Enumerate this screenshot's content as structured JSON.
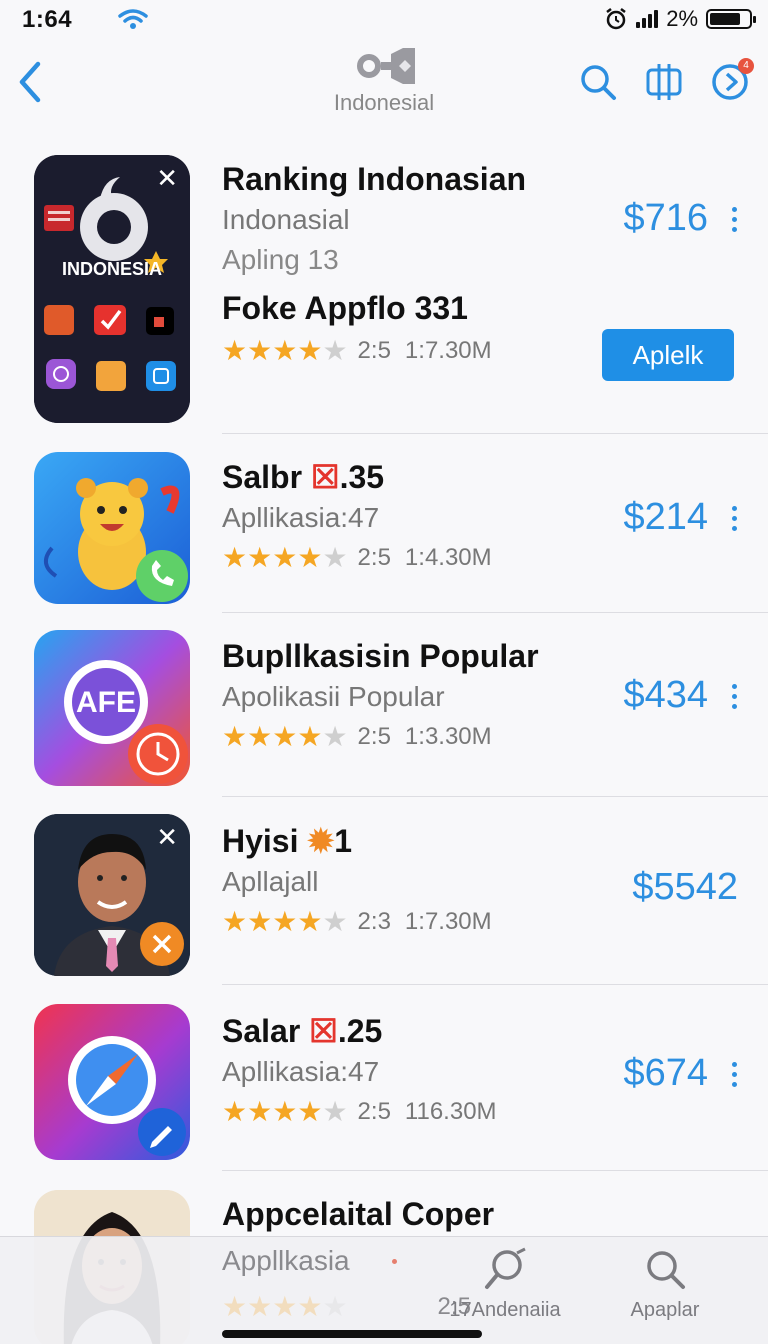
{
  "status": {
    "time": "1:64",
    "battery": "2%"
  },
  "nav": {
    "title": "Indonesial",
    "badge": "4"
  },
  "featured": {
    "name": "Ranking Indonasian",
    "subtitle": "Indonasial",
    "line3": "Apling 13",
    "extra": "Foke Appflo 331",
    "rating": "2:5",
    "downloads": "1:7.30M",
    "price": "$716",
    "button": "Aplelk",
    "icon_label": "INDONESIA"
  },
  "apps": [
    {
      "name": "Salbr",
      "name_suffix": ".35",
      "sub": "Apllikasia:47",
      "rating": "2:5",
      "downloads": "1:4.30M",
      "price": "$214",
      "stars": 4
    },
    {
      "name": "Bupllkasisin Popular",
      "name_suffix": "",
      "sub": "Apolikasii Popular",
      "rating": "2:5",
      "downloads": "1:3.30M",
      "price": "$434",
      "stars": 4,
      "icon_label": "AFE"
    },
    {
      "name": "Hyisi",
      "name_suffix": "1",
      "sub": "Apllajall",
      "rating": "2:3",
      "downloads": "1:7.30M",
      "price": "$5542",
      "stars": 4
    },
    {
      "name": "Salar",
      "name_suffix": ".25",
      "sub": "Apllikasia:47",
      "rating": "2:5",
      "downloads": "116.30M",
      "price": "$674",
      "stars": 4
    }
  ],
  "last_app": {
    "name": "Appcelaital Coper",
    "sub": "Appllkasia",
    "rating": "2:5"
  },
  "tabs": [
    {
      "label": "17Andenaiia",
      "icon": "profile-search-icon"
    },
    {
      "label": "Apaplar",
      "icon": "search-icon"
    }
  ],
  "colors": {
    "accent": "#2d8fe0",
    "button": "#1f8fe6",
    "star": "#f5a623"
  }
}
